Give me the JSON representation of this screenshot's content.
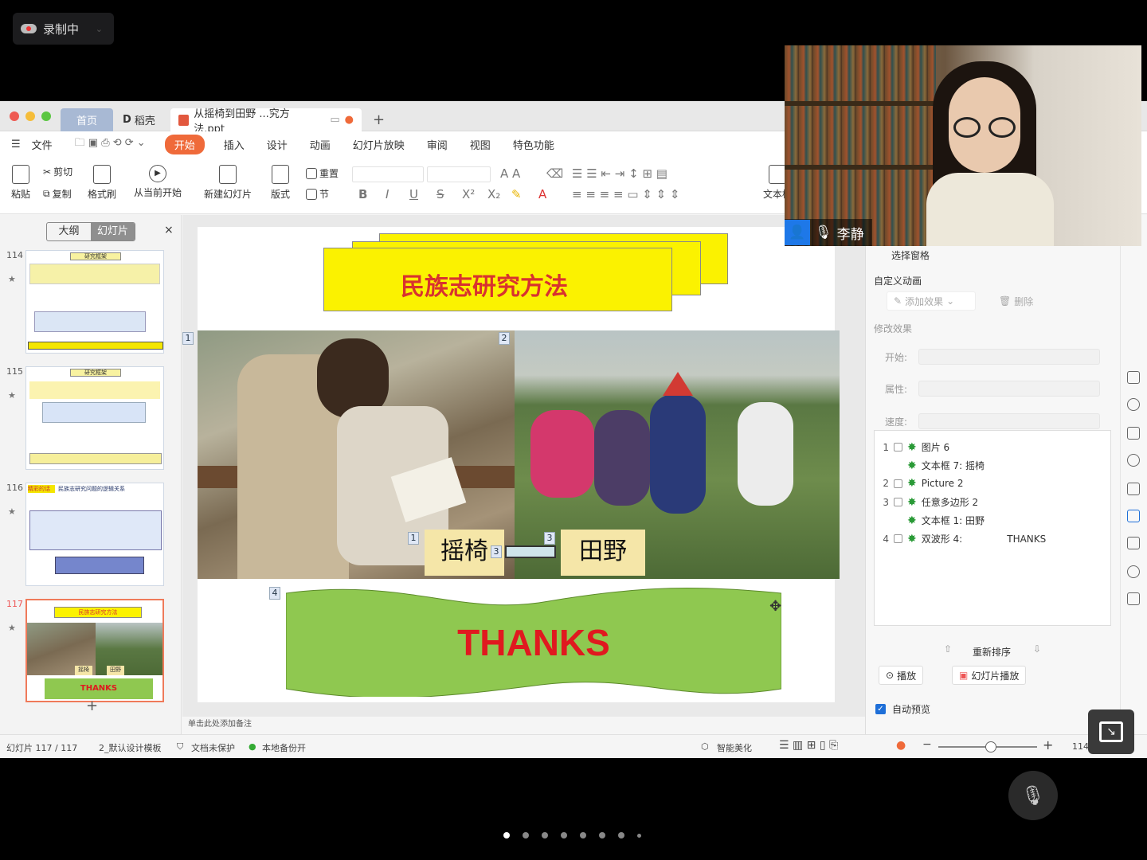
{
  "recording": {
    "label": "录制中"
  },
  "tabs": {
    "home": "首页",
    "daoke": "稻壳",
    "file": "从摇椅到田野 ...究方法.ppt",
    "add": "+"
  },
  "menu": {
    "file": "文件",
    "items": [
      "开始",
      "插入",
      "设计",
      "动画",
      "幻灯片放映",
      "审阅",
      "视图",
      "特色功能"
    ]
  },
  "ribbon": {
    "paste": "粘贴",
    "cut": "剪切",
    "copy": "复制",
    "format_painter": "格式刷",
    "from_current": "从当前开始",
    "new_slide": "新建幻灯片",
    "layout": "版式",
    "reset": "重置",
    "section": "节",
    "textbox": "文本框"
  },
  "left_panel": {
    "outline": "大纲",
    "slides": "幻灯片",
    "close": "×",
    "thumbs": [
      {
        "num": "114",
        "title": "研究框架"
      },
      {
        "num": "115",
        "title": "研究框架"
      },
      {
        "num": "116",
        "title": "民族志研究问题的逻辑关系",
        "tag": "精彩的话"
      },
      {
        "num": "117",
        "title": "民族志研究方法",
        "thanks": "THANKS",
        "l1": "摇椅",
        "l2": "田野"
      }
    ]
  },
  "slide": {
    "title": "民族志研究方法",
    "label_left": "摇椅",
    "label_right": "田野",
    "thanks": "THANKS",
    "tags": [
      "1",
      "2",
      "1",
      "3",
      "3",
      "4"
    ]
  },
  "notes": "单击此处添加备注",
  "right_panel": {
    "select_pane": "选择窗格",
    "custom_anim": "自定义动画",
    "add_effect": "添加效果",
    "delete": "删除",
    "modify": "修改效果",
    "start": "开始:",
    "property": "属性:",
    "speed": "速度:",
    "anim_items": [
      {
        "n": "1",
        "label": "图片 6"
      },
      {
        "n": "",
        "label": "文本框 7: 摇椅"
      },
      {
        "n": "2",
        "label": "Picture 2"
      },
      {
        "n": "3",
        "label": "任意多边形 2"
      },
      {
        "n": "",
        "label": "文本框 1:  田野"
      },
      {
        "n": "4",
        "label": "双波形 4:",
        "extra": "THANKS"
      }
    ],
    "reorder": "重新排序",
    "play": "播放",
    "slideshow": "幻灯片播放",
    "autopreview": "自动预览"
  },
  "status": {
    "slide_info": "幻灯片 117 / 117",
    "template": "2_默认设计模板",
    "protect": "文档未保护",
    "backup": "本地备份开",
    "beautify": "智能美化",
    "zoom": "114"
  },
  "video": {
    "name": "李静"
  },
  "colors": {
    "accent": "#ef6a3a",
    "slide_title": "#d8322f",
    "banner": "#fbf200",
    "wave": "#8fc850",
    "thanks": "#e0191f"
  }
}
